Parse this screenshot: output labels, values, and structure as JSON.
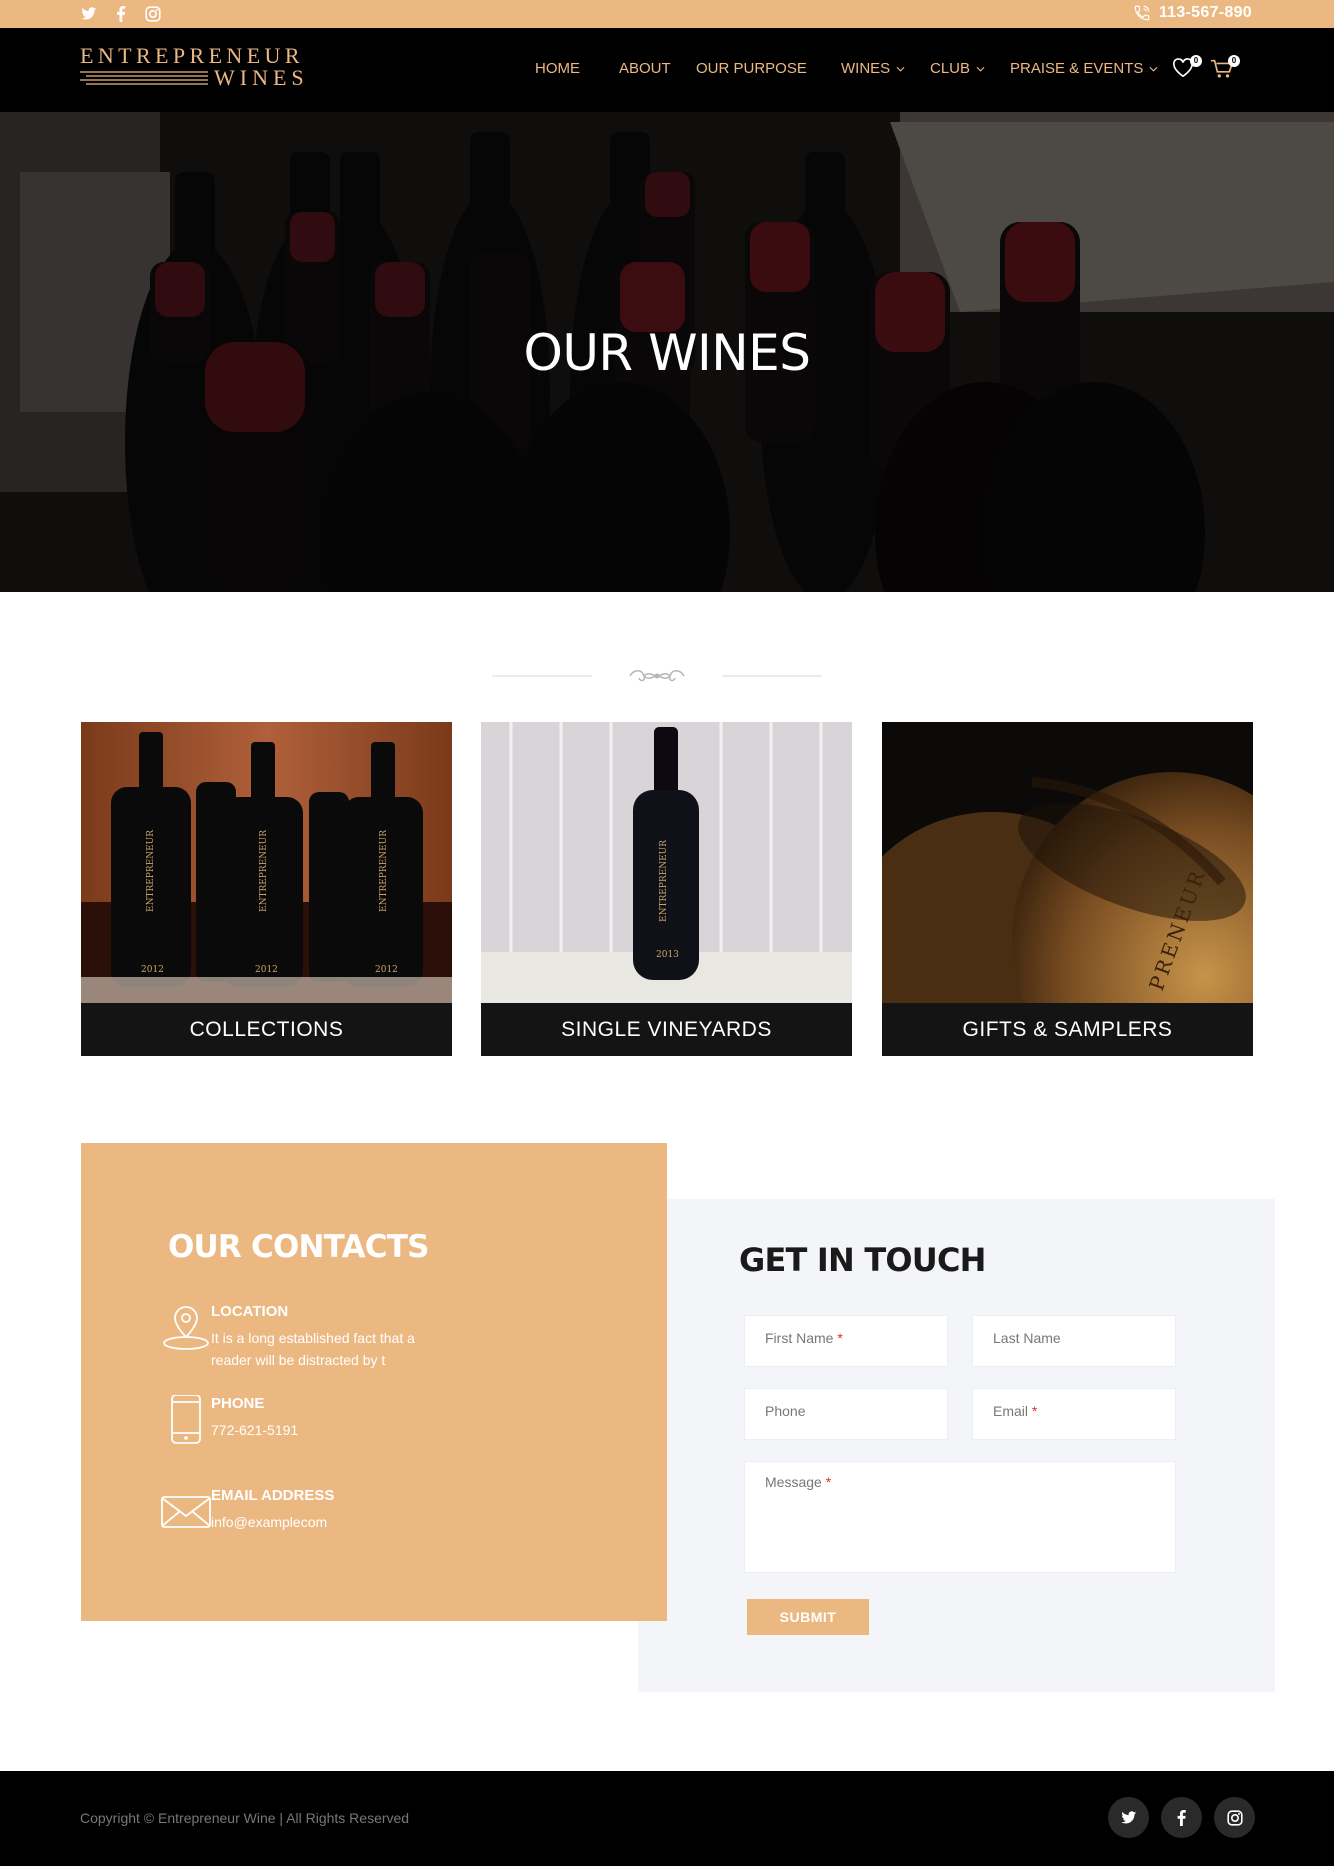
{
  "topbar": {
    "social": [
      "twitter-icon",
      "facebook-icon",
      "instagram-icon"
    ],
    "phone": "113-567-890"
  },
  "nav": {
    "logo_line1": "ENTREPRENEUR",
    "logo_line2": "WINES",
    "items": [
      {
        "label": "HOME",
        "dropdown": false
      },
      {
        "label": "ABOUT",
        "dropdown": false
      },
      {
        "label": "OUR PURPOSE",
        "dropdown": false
      },
      {
        "label": "WINES",
        "dropdown": true
      },
      {
        "label": "CLUB",
        "dropdown": true
      },
      {
        "label": "PRAISE & EVENTS",
        "dropdown": true
      }
    ],
    "wishlist_count": "0",
    "cart_count": "0"
  },
  "hero": {
    "title": "OUR WINES"
  },
  "categories": [
    {
      "label": "COLLECTIONS"
    },
    {
      "label": "SINGLE VINEYARDS"
    },
    {
      "label": "GIFTS & SAMPLERS"
    }
  ],
  "contacts": {
    "title": "OUR CONTACTS",
    "location_head": "LOCATION",
    "location_text": "It is a long established fact that a reader will be distracted by t",
    "phone_head": "PHONE",
    "phone_text": "772-621-5191",
    "email_head": "EMAIL ADDRESS",
    "email_text": "info@examplecom"
  },
  "form": {
    "title": "GET IN TOUCH",
    "first_name": "First Name",
    "last_name": "Last Name",
    "phone": "Phone",
    "email": "Email",
    "message": "Message",
    "required_mark": "*",
    "submit": "SUBMIT"
  },
  "footer": {
    "copyright": "Copyright © Entrepreneur Wine | All Rights Reserved",
    "social": [
      "twitter-icon",
      "facebook-icon",
      "instagram-icon"
    ]
  },
  "colors": {
    "accent": "#ecb882",
    "nav_bg": "#000000",
    "form_bg": "#f4f5f9",
    "required": "#d0342c"
  }
}
